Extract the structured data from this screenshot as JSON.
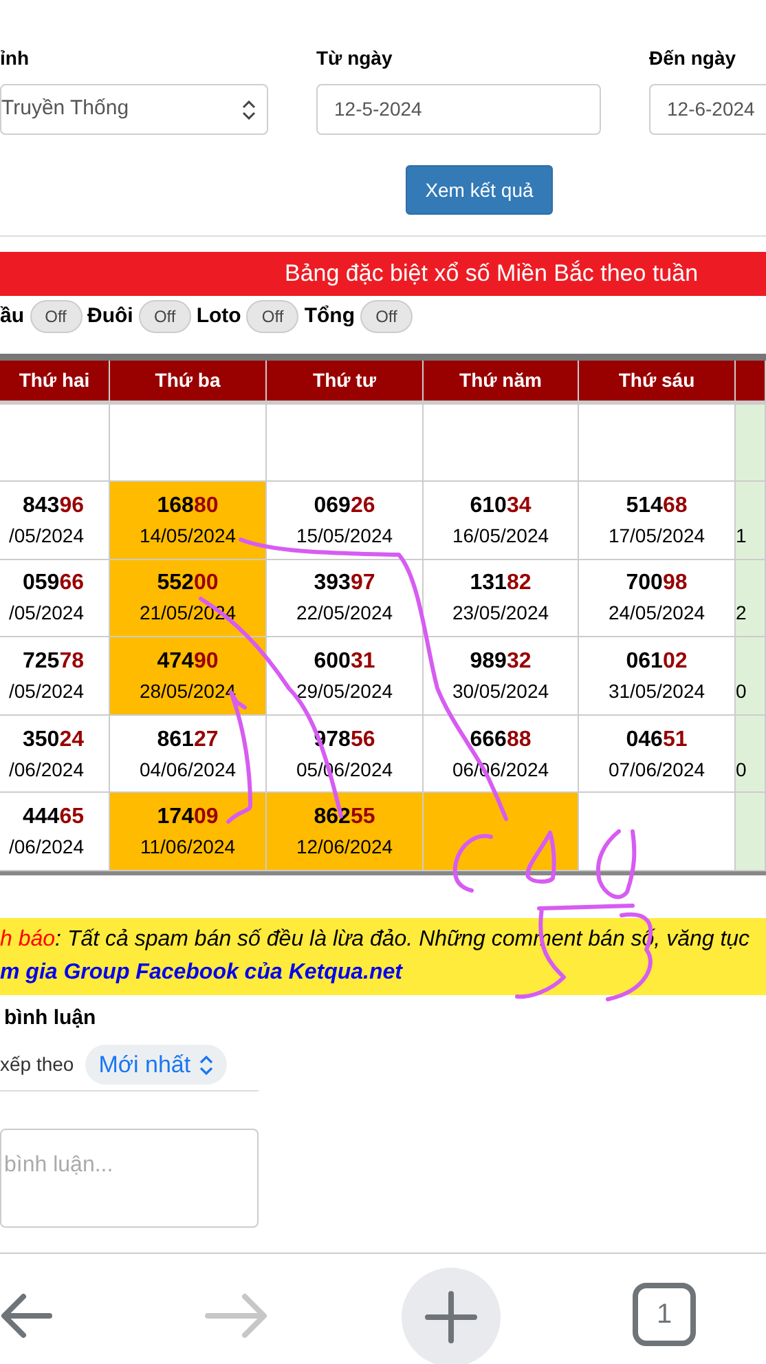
{
  "filters": [
    {
      "label": "ỉnh",
      "kind": "select",
      "value": "Truyền Thống"
    },
    {
      "label": "Từ ngày",
      "kind": "date",
      "value": "12-5-2024"
    },
    {
      "label": "Đến ngày",
      "kind": "date",
      "value": "12-6-2024"
    }
  ],
  "submit_button": "Xem kết quả",
  "banner": "Bảng đặc biệt xổ số Miền Bắc theo tuần",
  "toggles": [
    {
      "label": "ầu",
      "text": "Off",
      "on": false
    },
    {
      "label": "Đuôi",
      "text": "Off",
      "on": false
    },
    {
      "label": "Loto",
      "text": "Off",
      "on": false
    },
    {
      "label": "Tổng",
      "text": "Off",
      "on": false
    }
  ],
  "table": {
    "columns": [
      "Thứ hai",
      "Thứ ba",
      "Thứ tư",
      "Thứ năm",
      "Thứ sáu",
      ""
    ],
    "rows": [
      [
        {
          "head": "843",
          "tail": "96",
          "date": "/05/2024",
          "highlighted": false
        },
        {
          "head": "168",
          "tail": "80",
          "date": "14/05/2024",
          "highlighted": true
        },
        {
          "head": "069",
          "tail": "26",
          "date": "15/05/2024",
          "highlighted": false
        },
        {
          "head": "610",
          "tail": "34",
          "date": "16/05/2024",
          "highlighted": false
        },
        {
          "head": "514",
          "tail": "68",
          "date": "17/05/2024",
          "highlighted": false
        },
        {
          "date": "1",
          "highlighted": false
        }
      ],
      [
        {
          "head": "059",
          "tail": "66",
          "date": "/05/2024",
          "highlighted": false
        },
        {
          "head": "552",
          "tail": "00",
          "date": "21/05/2024",
          "highlighted": true
        },
        {
          "head": "393",
          "tail": "97",
          "date": "22/05/2024",
          "highlighted": false
        },
        {
          "head": "131",
          "tail": "82",
          "date": "23/05/2024",
          "highlighted": false
        },
        {
          "head": "700",
          "tail": "98",
          "date": "24/05/2024",
          "highlighted": false
        },
        {
          "date": "2",
          "highlighted": false
        }
      ],
      [
        {
          "head": "725",
          "tail": "78",
          "date": "/05/2024",
          "highlighted": false
        },
        {
          "head": "474",
          "tail": "90",
          "date": "28/05/2024",
          "highlighted": true
        },
        {
          "head": "600",
          "tail": "31",
          "date": "29/05/2024",
          "highlighted": false
        },
        {
          "head": "989",
          "tail": "32",
          "date": "30/05/2024",
          "highlighted": false
        },
        {
          "head": "061",
          "tail": "02",
          "date": "31/05/2024",
          "highlighted": false
        },
        {
          "date": "0",
          "highlighted": false
        }
      ],
      [
        {
          "head": "350",
          "tail": "24",
          "date": "/06/2024",
          "highlighted": false
        },
        {
          "head": "861",
          "tail": "27",
          "date": "04/06/2024",
          "highlighted": false
        },
        {
          "head": "978",
          "tail": "56",
          "date": "05/06/2024",
          "highlighted": false
        },
        {
          "head": "666",
          "tail": "88",
          "date": "06/06/2024",
          "highlighted": false
        },
        {
          "head": "046",
          "tail": "51",
          "date": "07/06/2024",
          "highlighted": false
        },
        {
          "date": "0",
          "highlighted": false
        }
      ],
      [
        {
          "head": "444",
          "tail": "65",
          "date": "/06/2024",
          "highlighted": false
        },
        {
          "head": "174",
          "tail": "09",
          "date": "11/06/2024",
          "highlighted": true
        },
        {
          "head": "862",
          "tail": "55",
          "date": "12/06/2024",
          "highlighted": true
        },
        {
          "highlighted": true
        },
        {
          "highlighted": false
        },
        {
          "highlighted": false
        }
      ]
    ]
  },
  "notice": {
    "label": "h báo",
    "text": ": Tất cả spam bán số đều là lừa đảo. Những comment bán số, văng tục",
    "link": "m gia Group Facebook của Ketqua.net"
  },
  "comments": {
    "title": "bình luận",
    "sort_label": "xếp theo",
    "sort_value": "Mới nhất",
    "placeholder": "bình luận..."
  },
  "toolbar": {
    "forward_disabled": true,
    "tab_count": "1"
  }
}
